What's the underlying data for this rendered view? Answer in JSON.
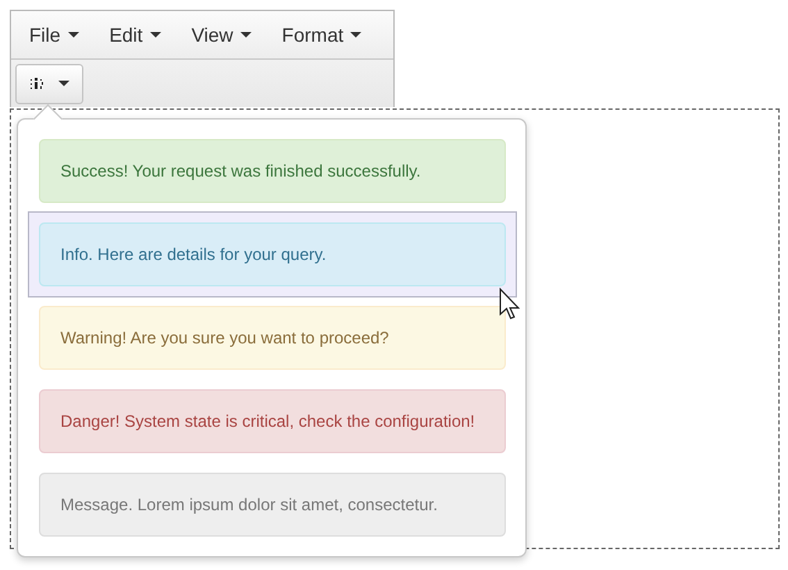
{
  "menubar": [
    {
      "label": "File"
    },
    {
      "label": "Edit"
    },
    {
      "label": "View"
    },
    {
      "label": "Format"
    }
  ],
  "popover": {
    "alerts": [
      {
        "kind": "success",
        "text": "Success! Your request was finished successfully.",
        "selected": false
      },
      {
        "kind": "info",
        "text": "Info. Here are details for your query.",
        "selected": true
      },
      {
        "kind": "warning",
        "text": "Warning! Are you sure you want to proceed?",
        "selected": false
      },
      {
        "kind": "danger",
        "text": "Danger! System state is critical, check the configuration!",
        "selected": false
      },
      {
        "kind": "message",
        "text": "Message. Lorem ipsum dolor sit amet, consectetur.",
        "selected": false
      }
    ]
  }
}
